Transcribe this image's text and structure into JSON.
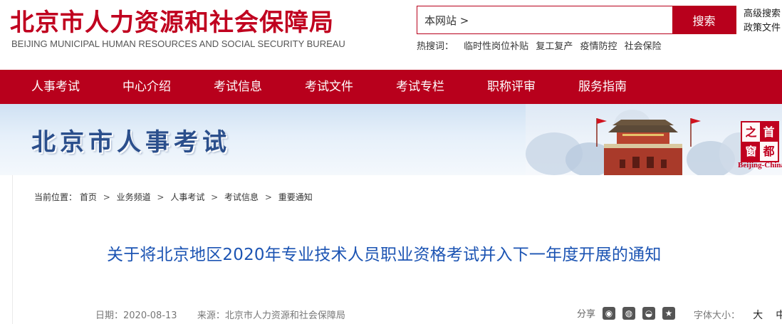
{
  "header": {
    "title": "北京市人力资源和社会保障局",
    "subtitle": "BEIJING MUNICIPAL HUMAN RESOURCES AND SOCIAL SECURITY BUREAU",
    "search": {
      "value": "本网站 >",
      "button": "搜索"
    },
    "links": {
      "advanced": "高级搜索",
      "policy": "政策文件"
    },
    "hot": {
      "label": "热搜词：",
      "items": [
        "临时性岗位补贴",
        "复工复产",
        "疫情防控",
        "社会保险"
      ]
    }
  },
  "nav": {
    "items": [
      "人事考试",
      "中心介绍",
      "考试信息",
      "考试文件",
      "考试专栏",
      "职称评审",
      "服务指南"
    ]
  },
  "banner": {
    "title": "北京市人事考试",
    "seal": [
      "之",
      "首",
      "窗",
      "都"
    ],
    "seal_caption": "Beijing-China"
  },
  "breadcrumb": {
    "label": "当前位置：",
    "items": [
      "首页",
      "业务频道",
      "人事考试",
      "考试信息",
      "重要通知"
    ],
    "separator": ">"
  },
  "article": {
    "title": "关于将北京地区2020年专业技术人员职业资格考试并入下一年度开展的通知",
    "date_label": "日期：",
    "date": "2020-08-13",
    "source_label": "来源：",
    "source": "北京市人力资源和社会保障局"
  },
  "share": {
    "label": "分享",
    "icons": [
      {
        "name": "weibo-icon",
        "glyph": "◉",
        "color": "#555555"
      },
      {
        "name": "wechat-icon",
        "glyph": "◍",
        "color": "#555555"
      },
      {
        "name": "qq-icon",
        "glyph": "◒",
        "color": "#555555"
      },
      {
        "name": "qzone-icon",
        "glyph": "★",
        "color": "#555555"
      }
    ]
  },
  "font_size": {
    "label": "字体大小：",
    "large": "大",
    "medium": "中"
  },
  "colors": {
    "brand_red": "#b8001c",
    "title_blue": "#1c54b3",
    "banner_blue": "#2b4f8c"
  }
}
